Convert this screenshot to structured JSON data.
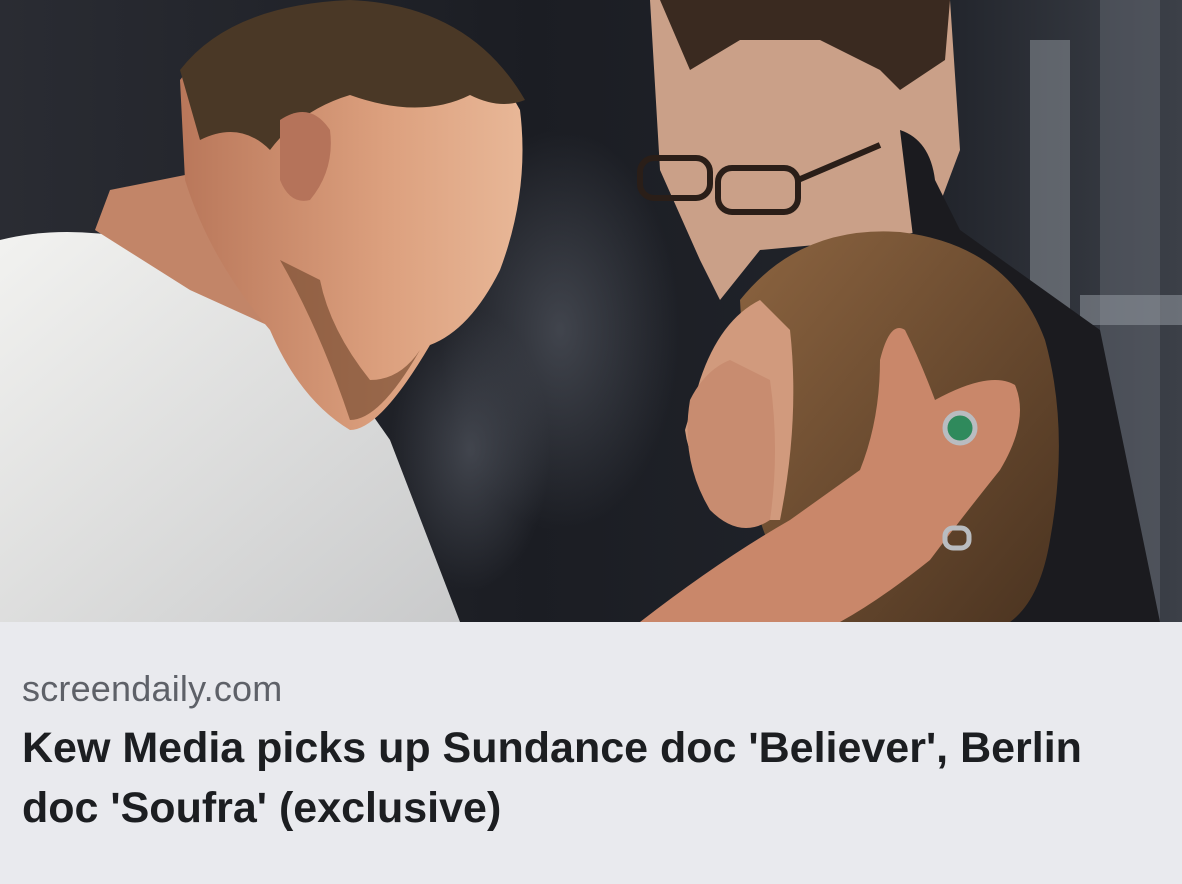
{
  "link_preview": {
    "source_domain": "screendaily.com",
    "headline": "Kew Media picks up Sundance doc 'Believer', Berlin doc 'Soufra' (exclusive)",
    "image": {
      "alt": "",
      "palette": {
        "background": "#1a1c22",
        "shirt": "#e4e4e2",
        "skin": "#c98b68",
        "hair_dark": "#3b2a1e",
        "hair_light": "#7a5634",
        "ring_stone": "#2f8a5c"
      }
    },
    "footer_background": "#e9eaee"
  }
}
